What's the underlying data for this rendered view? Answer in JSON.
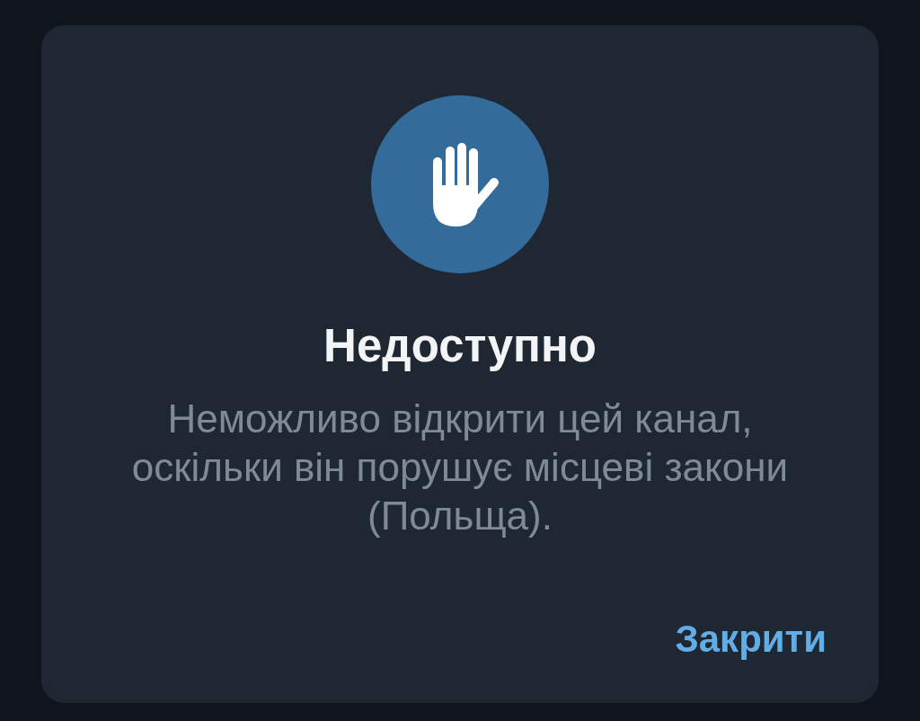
{
  "dialog": {
    "title": "Недоступно",
    "message": "Неможливо відкрити цей канал, оскільки він порушує місцеві закони (Польща).",
    "buttons": [
      {
        "label": "Закрити"
      }
    ]
  }
}
